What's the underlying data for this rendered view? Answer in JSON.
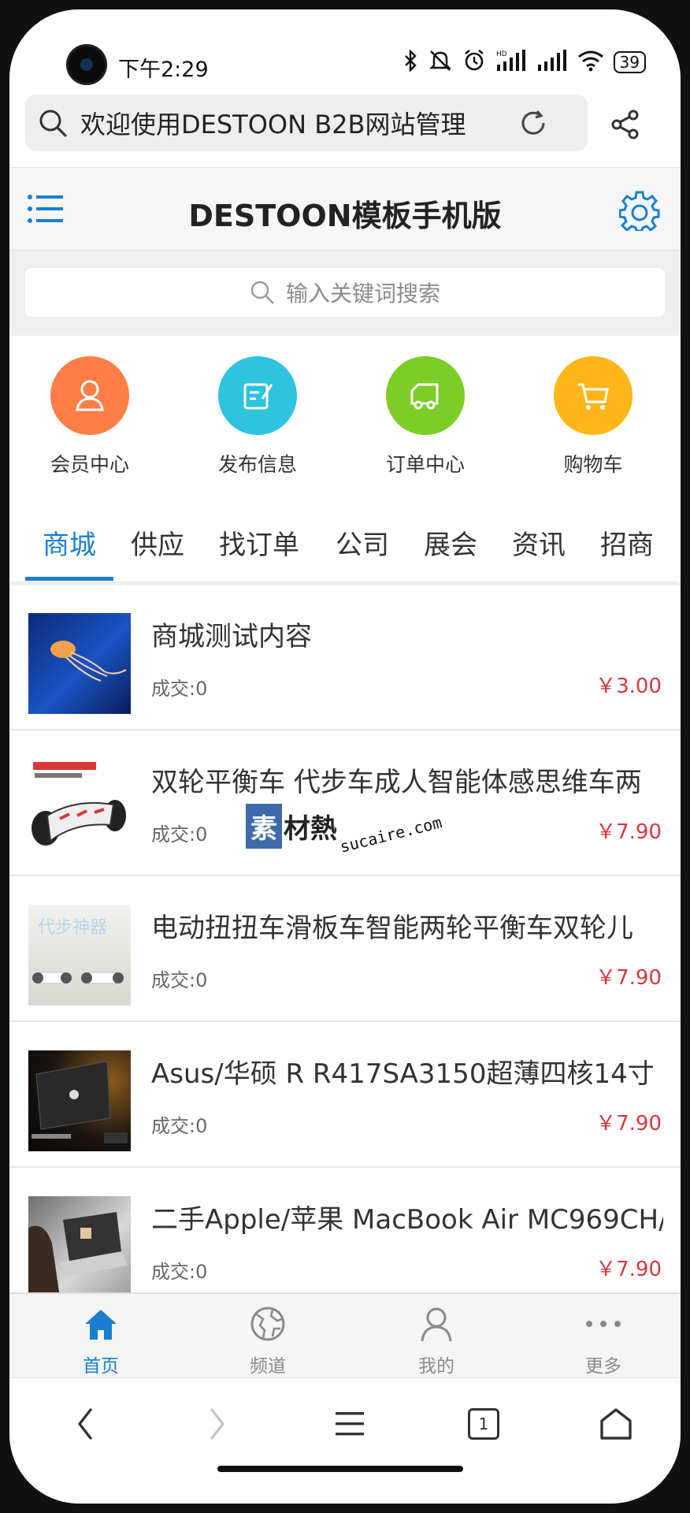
{
  "status_bar": {
    "time": "下午2:29",
    "battery": "39",
    "network_label": "HD"
  },
  "browser": {
    "url_text": "欢迎使用DESTOON B2B网站管理"
  },
  "header": {
    "title": "DESTOON模板手机版"
  },
  "search": {
    "placeholder": "输入关键词搜索"
  },
  "quick_links": [
    {
      "label": "会员中心",
      "icon": "user-icon",
      "color": "#ff7e47"
    },
    {
      "label": "发布信息",
      "icon": "edit-icon",
      "color": "#2ec3df"
    },
    {
      "label": "订单中心",
      "icon": "truck-icon",
      "color": "#7ccd26"
    },
    {
      "label": "购物车",
      "icon": "cart-icon",
      "color": "#ffb61b"
    }
  ],
  "tabs": [
    {
      "label": "商城",
      "active": true
    },
    {
      "label": "供应"
    },
    {
      "label": "找订单"
    },
    {
      "label": "公司"
    },
    {
      "label": "展会"
    },
    {
      "label": "资讯"
    },
    {
      "label": "招商"
    }
  ],
  "products": [
    {
      "title": "商城测试内容",
      "sales": "成交:0",
      "price": "￥3.00"
    },
    {
      "title": "双轮平衡车 代步车成人智能体感思维车两",
      "sales": "成交:0",
      "price": "￥7.90"
    },
    {
      "title": "电动扭扭车滑板车智能两轮平衡车双轮儿",
      "sales": "成交:0",
      "price": "￥7.90"
    },
    {
      "title": "Asus/华硕 R R417SA3150超薄四核14寸",
      "sales": "成交:0",
      "price": "￥7.90"
    },
    {
      "title": "二手Apple/苹果 MacBook Air MC969CH/",
      "sales": "成交:0",
      "price": "￥7.90"
    }
  ],
  "watermark": {
    "box": "素",
    "text": "材熱",
    "url": "sucaire.com"
  },
  "bottom_nav": [
    {
      "label": "首页",
      "active": true
    },
    {
      "label": "频道"
    },
    {
      "label": "我的"
    },
    {
      "label": "更多"
    }
  ],
  "browser_bar": {
    "tab_count": "1"
  },
  "colors": {
    "accent": "#1a7fd1",
    "price": "#d8383c"
  }
}
